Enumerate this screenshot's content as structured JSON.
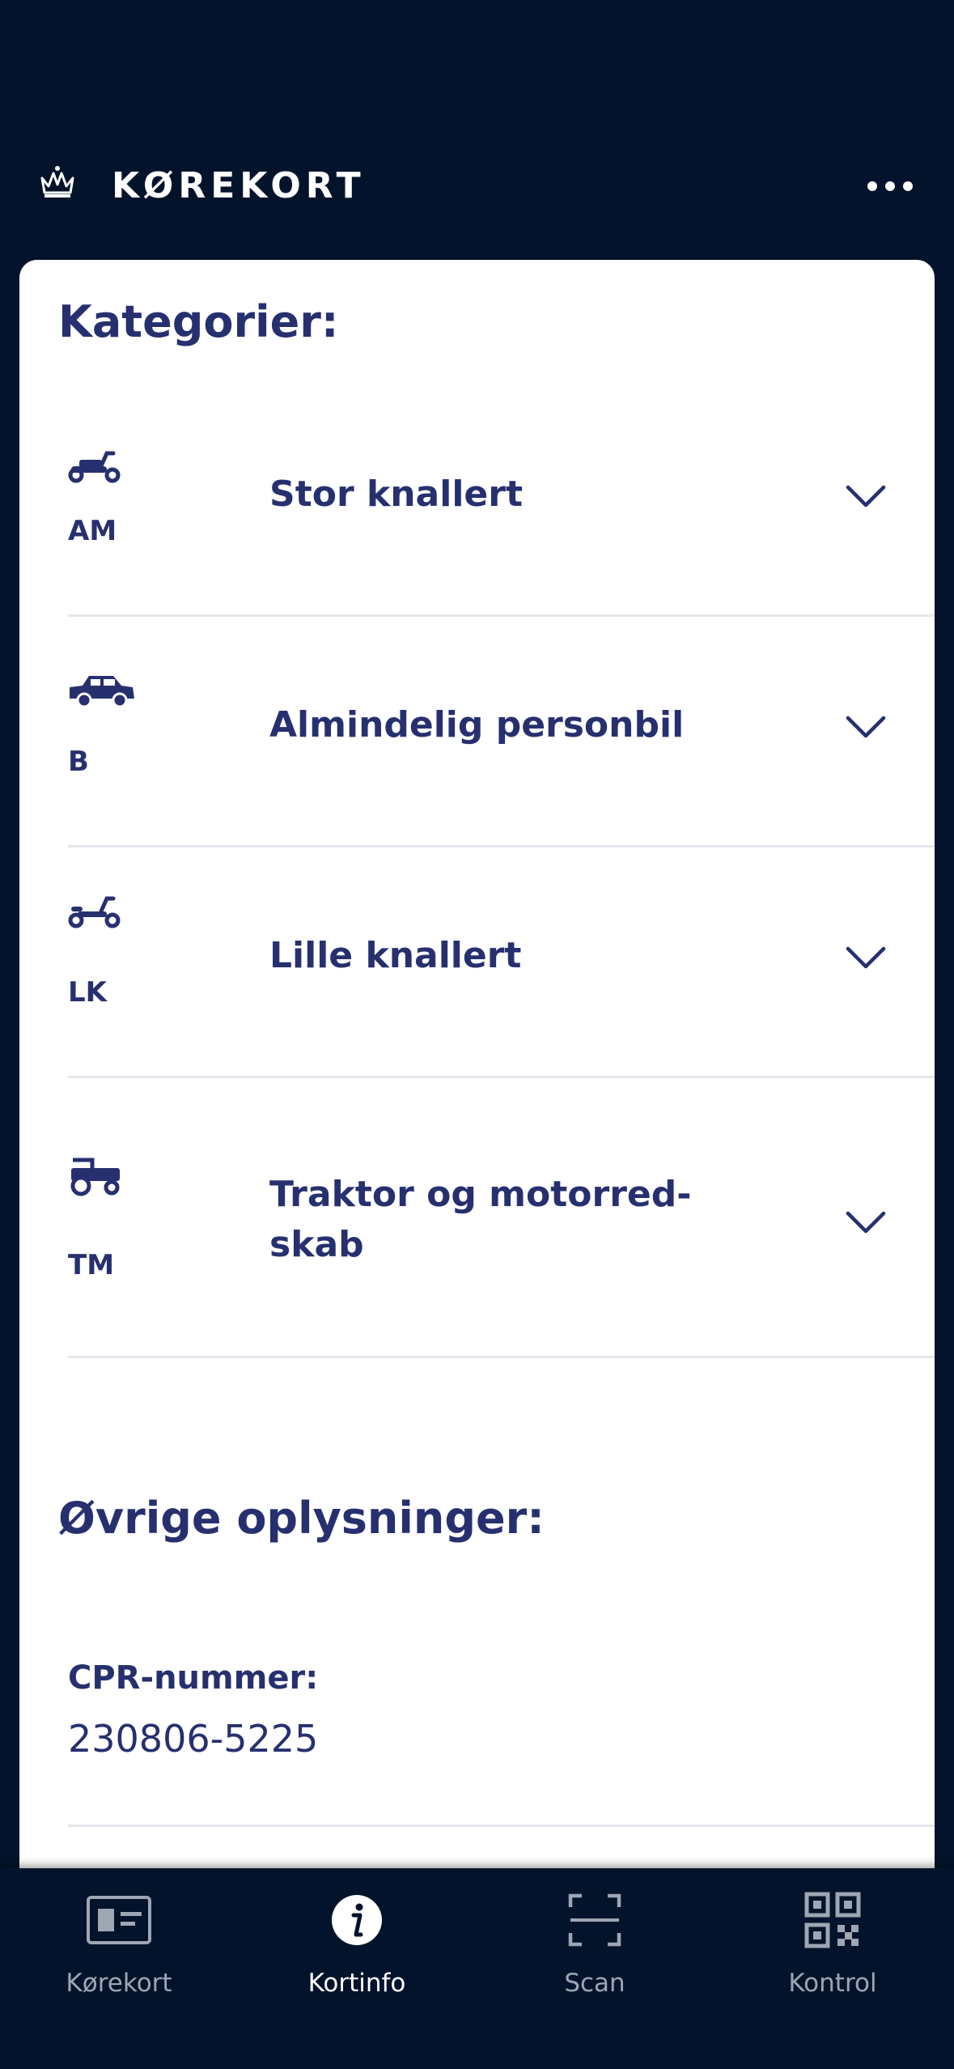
{
  "header": {
    "title": "KØREKORT",
    "crown_icon": "crown-icon",
    "more_icon": "more-horizontal-icon"
  },
  "categories_section": {
    "title": "Kategorier:",
    "items": [
      {
        "code": "AM",
        "label": "Stor knallert",
        "icon": "moped-icon"
      },
      {
        "code": "B",
        "label": "Almindelig personbil",
        "icon": "car-icon"
      },
      {
        "code": "LK",
        "label": "Lille knallert",
        "icon": "small-moped-icon"
      },
      {
        "code": "TM",
        "label": "Traktor og motorred-\nskab",
        "label_line1": "Traktor og motorred-",
        "label_line2": "skab",
        "icon": "tractor-icon"
      }
    ]
  },
  "other_section": {
    "title": "Øvrige oplysninger:",
    "cpr_label": "CPR-nummer:",
    "cpr_value": "230806-5225"
  },
  "bottom_nav": {
    "items": [
      {
        "label": "Kørekort",
        "icon": "license-card-icon",
        "active": false
      },
      {
        "label": "Kortinfo",
        "icon": "info-icon",
        "active": true
      },
      {
        "label": "Scan",
        "icon": "scan-icon",
        "active": false
      },
      {
        "label": "Kontrol",
        "icon": "qr-code-icon",
        "active": false
      }
    ]
  },
  "colors": {
    "background": "#02132b",
    "card": "#ffffff",
    "accent": "#27306f",
    "divider": "#e6e7ee",
    "nav_inactive": "#9ea6b3"
  }
}
